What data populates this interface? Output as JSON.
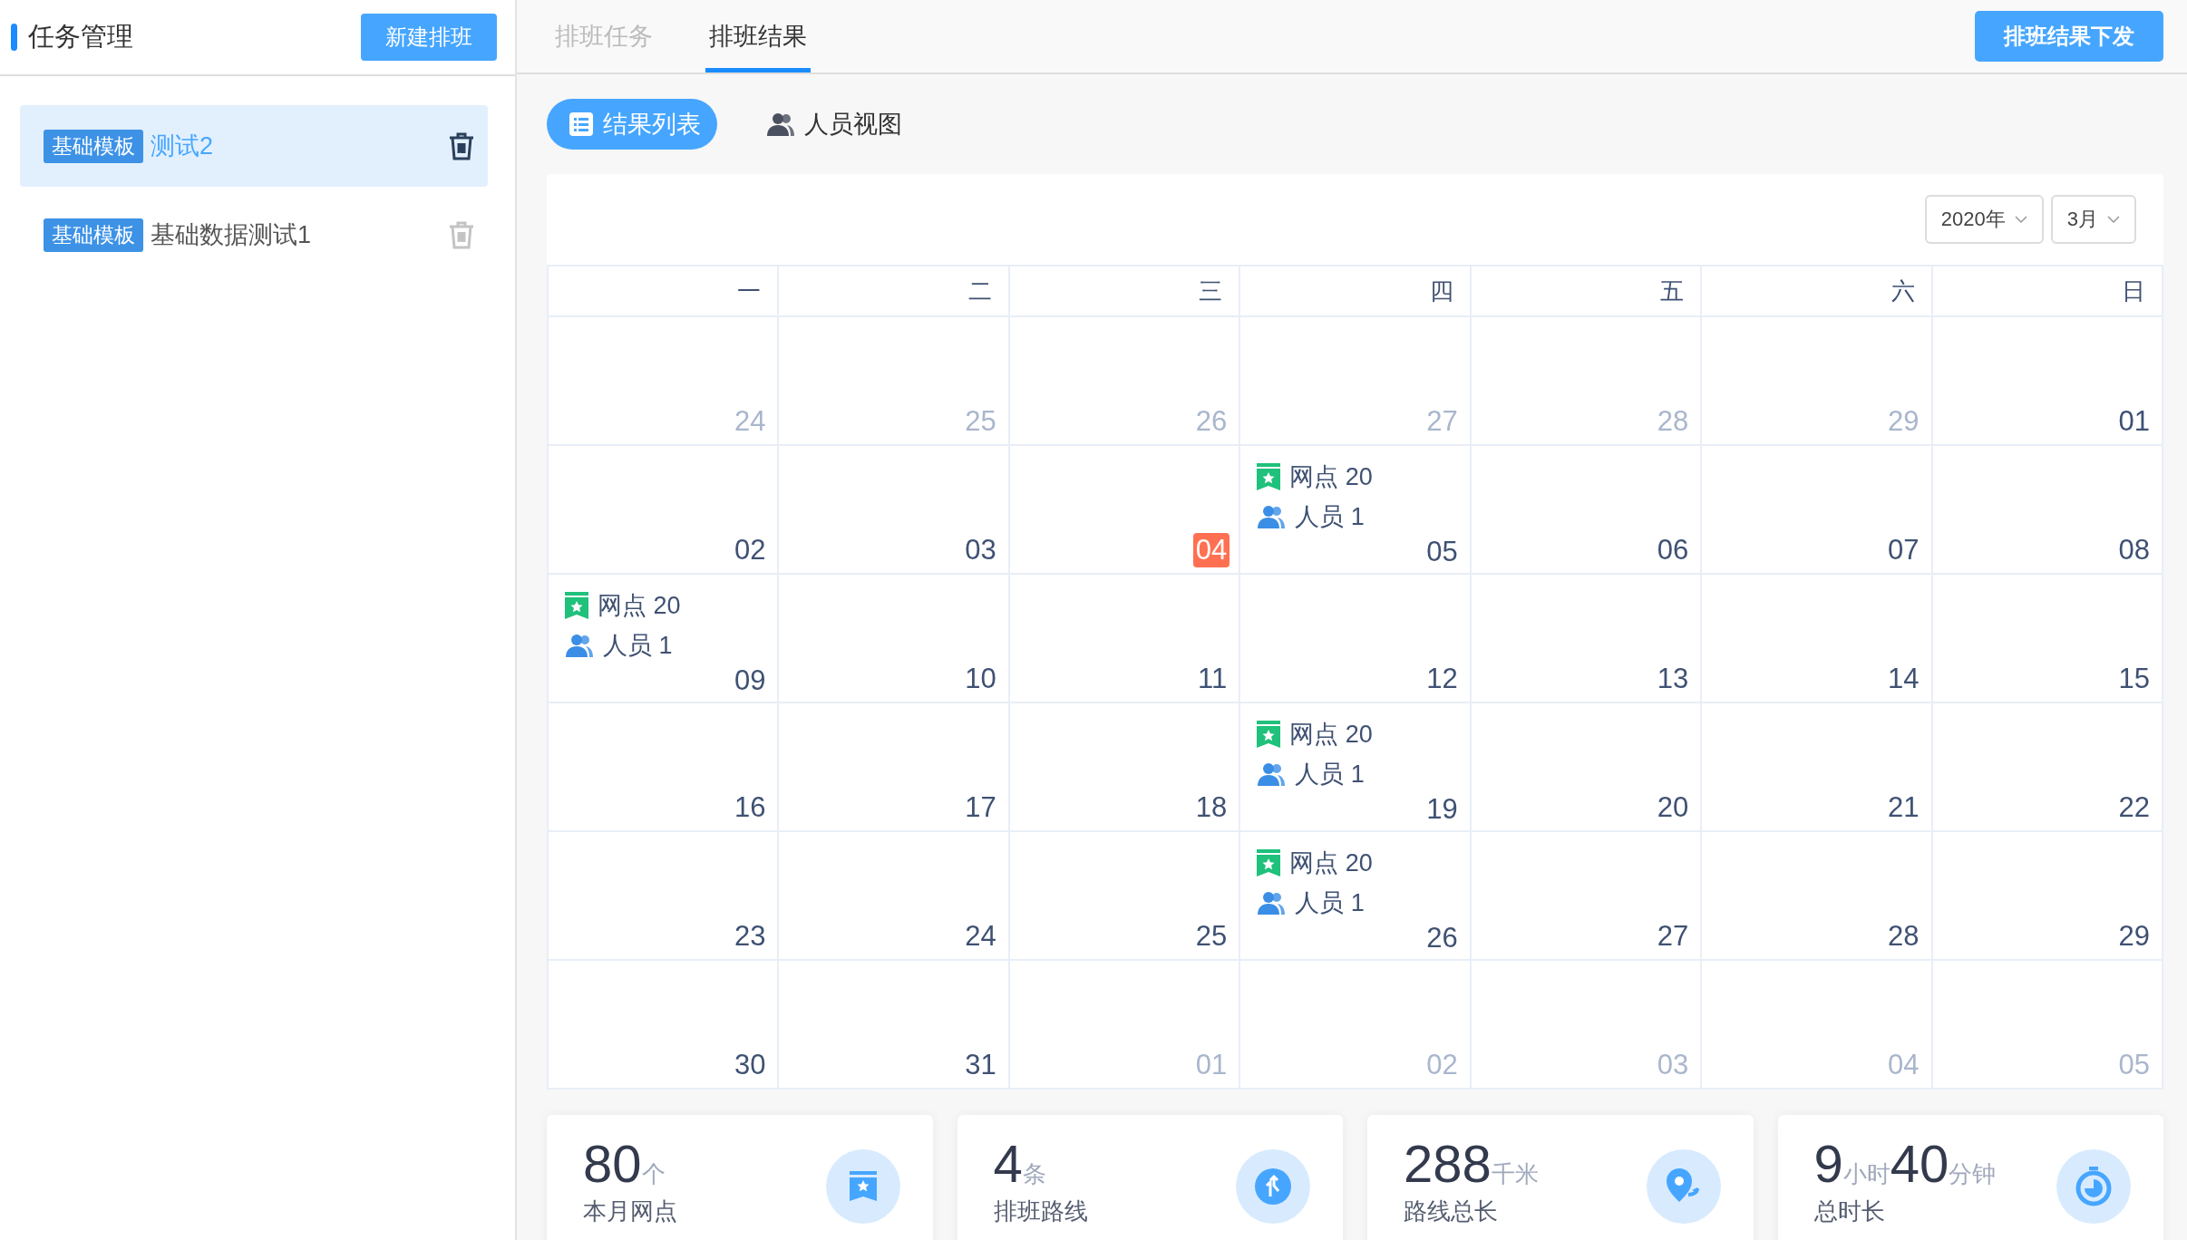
{
  "sidebar": {
    "title": "任务管理",
    "new_button": "新建排班",
    "items": [
      {
        "tag": "基础模板",
        "name": "测试2",
        "selected": true
      },
      {
        "tag": "基础模板",
        "name": "基础数据测试1",
        "selected": false
      }
    ]
  },
  "tabs": [
    {
      "label": "排班任务",
      "selected": false
    },
    {
      "label": "排班结果",
      "selected": true
    }
  ],
  "publish_button": "排班结果下发",
  "views": [
    {
      "kind": "list",
      "label": "结果列表",
      "selected": true
    },
    {
      "kind": "people",
      "label": "人员视图",
      "selected": false
    }
  ],
  "calendar": {
    "year": "2020年",
    "month": "3月",
    "weekdays": [
      "一",
      "二",
      "三",
      "四",
      "五",
      "六",
      "日"
    ],
    "weeks": [
      [
        {
          "day": "24",
          "muted": true
        },
        {
          "day": "25",
          "muted": true
        },
        {
          "day": "26",
          "muted": true
        },
        {
          "day": "27",
          "muted": true
        },
        {
          "day": "28",
          "muted": true
        },
        {
          "day": "29",
          "muted": true
        },
        {
          "day": "01",
          "muted": false
        }
      ],
      [
        {
          "day": "02",
          "muted": false
        },
        {
          "day": "03",
          "muted": false
        },
        {
          "day": "04",
          "muted": false,
          "today": true
        },
        {
          "day": "05",
          "muted": false,
          "events": [
            {
              "kind": "site",
              "text": "网点 20"
            },
            {
              "kind": "staff",
              "text": "人员 1"
            }
          ]
        },
        {
          "day": "06",
          "muted": false
        },
        {
          "day": "07",
          "muted": false
        },
        {
          "day": "08",
          "muted": false
        }
      ],
      [
        {
          "day": "09",
          "muted": false,
          "events": [
            {
              "kind": "site",
              "text": "网点 20"
            },
            {
              "kind": "staff",
              "text": "人员 1"
            }
          ]
        },
        {
          "day": "10",
          "muted": false
        },
        {
          "day": "11",
          "muted": false
        },
        {
          "day": "12",
          "muted": false
        },
        {
          "day": "13",
          "muted": false
        },
        {
          "day": "14",
          "muted": false
        },
        {
          "day": "15",
          "muted": false
        }
      ],
      [
        {
          "day": "16",
          "muted": false
        },
        {
          "day": "17",
          "muted": false
        },
        {
          "day": "18",
          "muted": false
        },
        {
          "day": "19",
          "muted": false,
          "events": [
            {
              "kind": "site",
              "text": "网点 20"
            },
            {
              "kind": "staff",
              "text": "人员 1"
            }
          ]
        },
        {
          "day": "20",
          "muted": false
        },
        {
          "day": "21",
          "muted": false
        },
        {
          "day": "22",
          "muted": false
        }
      ],
      [
        {
          "day": "23",
          "muted": false
        },
        {
          "day": "24",
          "muted": false
        },
        {
          "day": "25",
          "muted": false
        },
        {
          "day": "26",
          "muted": false,
          "events": [
            {
              "kind": "site",
              "text": "网点 20"
            },
            {
              "kind": "staff",
              "text": "人员 1"
            }
          ]
        },
        {
          "day": "27",
          "muted": false
        },
        {
          "day": "28",
          "muted": false
        },
        {
          "day": "29",
          "muted": false
        }
      ],
      [
        {
          "day": "30",
          "muted": false
        },
        {
          "day": "31",
          "muted": false
        },
        {
          "day": "01",
          "muted": true
        },
        {
          "day": "02",
          "muted": true
        },
        {
          "day": "03",
          "muted": true
        },
        {
          "day": "04",
          "muted": true
        },
        {
          "day": "05",
          "muted": true
        }
      ]
    ]
  },
  "stats": [
    {
      "kind": "site",
      "parts": [
        {
          "num": "80",
          "unit": "个"
        }
      ],
      "label": "本月网点"
    },
    {
      "kind": "route",
      "parts": [
        {
          "num": "4",
          "unit": "条"
        }
      ],
      "label": "排班路线"
    },
    {
      "kind": "distance",
      "parts": [
        {
          "num": "288",
          "unit": "千米"
        }
      ],
      "label": "路线总长"
    },
    {
      "kind": "time",
      "parts": [
        {
          "num": "9",
          "unit": "小时"
        },
        {
          "num": "40",
          "unit": "分钟"
        }
      ],
      "label": "总时长"
    }
  ]
}
